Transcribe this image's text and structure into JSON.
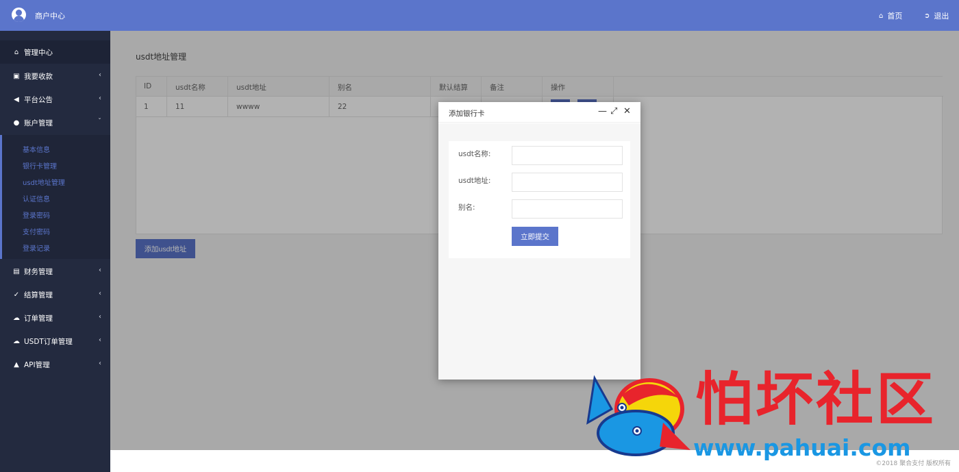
{
  "header": {
    "brand": "商户中心",
    "home_label": "首页",
    "logout_label": "退出"
  },
  "sidebar": {
    "items": [
      {
        "label": "管理中心",
        "icon": "home-icon"
      },
      {
        "label": "我要收款",
        "icon": "lock-icon"
      },
      {
        "label": "平台公告",
        "icon": "volume-icon"
      },
      {
        "label": "账户管理",
        "icon": "user-icon"
      },
      {
        "label": "财务管理",
        "icon": "money-icon"
      },
      {
        "label": "结算管理",
        "icon": "check-icon"
      },
      {
        "label": "订单管理",
        "icon": "cloud-icon"
      },
      {
        "label": "USDT订单管理",
        "icon": "cloud-icon"
      },
      {
        "label": "API管理",
        "icon": "bank-icon"
      }
    ],
    "sub_items": [
      "基本信息",
      "银行卡管理",
      "usdt地址管理",
      "认证信息",
      "登录密码",
      "支付密码",
      "登录记录"
    ]
  },
  "main": {
    "breadcrumb": "usdt地址管理",
    "table": {
      "headers": [
        "ID",
        "usdt名称",
        "usdt地址",
        "别名",
        "默认结算",
        "备注",
        "操作"
      ],
      "rows": [
        {
          "id": "1",
          "name": "11",
          "address": "wwww",
          "alias": "22"
        }
      ]
    },
    "add_button": "添加usdt地址"
  },
  "modal": {
    "title": "添加银行卡",
    "fields": [
      {
        "label": "usdt名称:",
        "value": ""
      },
      {
        "label": "usdt地址:",
        "value": ""
      },
      {
        "label": "别名:",
        "value": ""
      }
    ],
    "submit_label": "立即提交"
  },
  "footer": {
    "copyright": "©2018 聚合支付 版权所有"
  },
  "watermark": {
    "title": "怕坏社区",
    "url": "www.pahuai.com"
  },
  "colors": {
    "accent": "#5b75cb",
    "sidebar_bg": "#232a3f",
    "watermark_red": "#e8242c",
    "watermark_blue": "#1a97e3"
  }
}
